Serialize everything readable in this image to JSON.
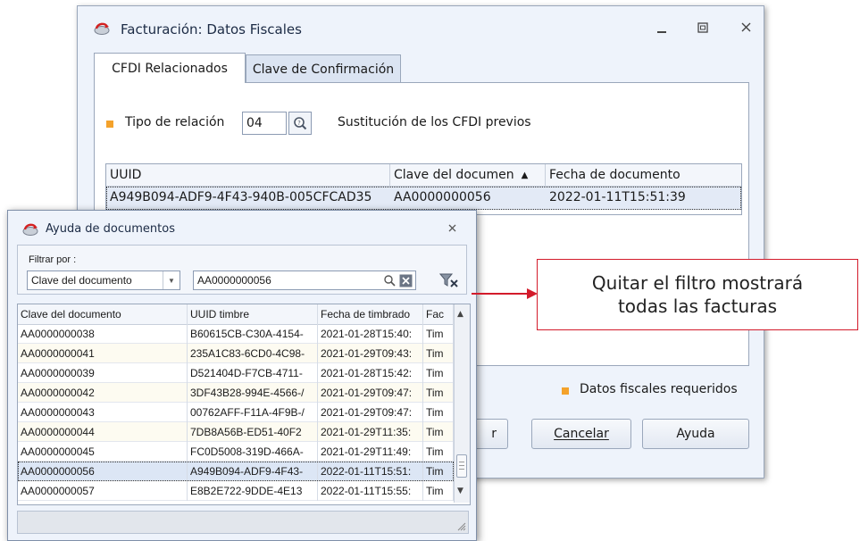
{
  "main_window": {
    "title": "Facturación: Datos Fiscales",
    "tabs": [
      "CFDI Relacionados",
      "Clave de Confirmación"
    ],
    "tipo_relacion_label": "Tipo de relación",
    "tipo_relacion_value": "04",
    "tipo_relacion_desc": "Sustitución de los CFDI previos",
    "grid": {
      "columns": [
        "UUID",
        "Clave del documen",
        "Fecha de documento"
      ],
      "sort_indicator": "▲",
      "rows": [
        {
          "uuid": "A949B094-ADF9-4F43-940B-005CFCAD35",
          "clave": "AA0000000056",
          "fecha": "2022-01-11T15:51:39"
        }
      ]
    },
    "required_note": "Datos fiscales requeridos",
    "buttons": {
      "aceptar_partial": "r",
      "cancelar": "Cancelar",
      "ayuda": "Ayuda"
    }
  },
  "popup": {
    "title": "Ayuda de documentos",
    "filter_label": "Filtrar por :",
    "filter_field": "Clave del documento",
    "filter_value": "AA0000000056",
    "columns": [
      "Clave del documento",
      "UUID timbre",
      "Fecha de timbrado",
      "Fac"
    ],
    "rows": [
      [
        "AA0000000038",
        "B60615CB-C30A-4154-",
        "2021-01-28T15:40:",
        "Tim"
      ],
      [
        "AA0000000041",
        "235A1C83-6CD0-4C98-",
        "2021-01-29T09:43:",
        "Tim"
      ],
      [
        "AA0000000039",
        "D521404D-F7CB-4711-",
        "2021-01-28T15:42:",
        "Tim"
      ],
      [
        "AA0000000042",
        "3DF43B28-994E-4566-/",
        "2021-01-29T09:47:",
        "Tim"
      ],
      [
        "AA0000000043",
        "00762AFF-F11A-4F9B-/",
        "2021-01-29T09:47:",
        "Tim"
      ],
      [
        "AA0000000044",
        "7DB8A56B-ED51-40F2",
        "2021-01-29T11:35:",
        "Tim"
      ],
      [
        "AA0000000045",
        "FC0D5008-319D-466A-",
        "2021-01-29T11:49:",
        "Tim"
      ],
      [
        "AA0000000056",
        "A949B094-ADF9-4F43-",
        "2022-01-11T15:51:",
        "Tim"
      ],
      [
        "AA0000000057",
        "E8B2E722-9DDE-4E13",
        "2022-01-11T15:55:",
        "Tim"
      ]
    ],
    "selected_row": 7
  },
  "callout": {
    "line1": "Quitar el filtro mostrará",
    "line2": "todas las facturas",
    "color": "#d31b2b"
  }
}
